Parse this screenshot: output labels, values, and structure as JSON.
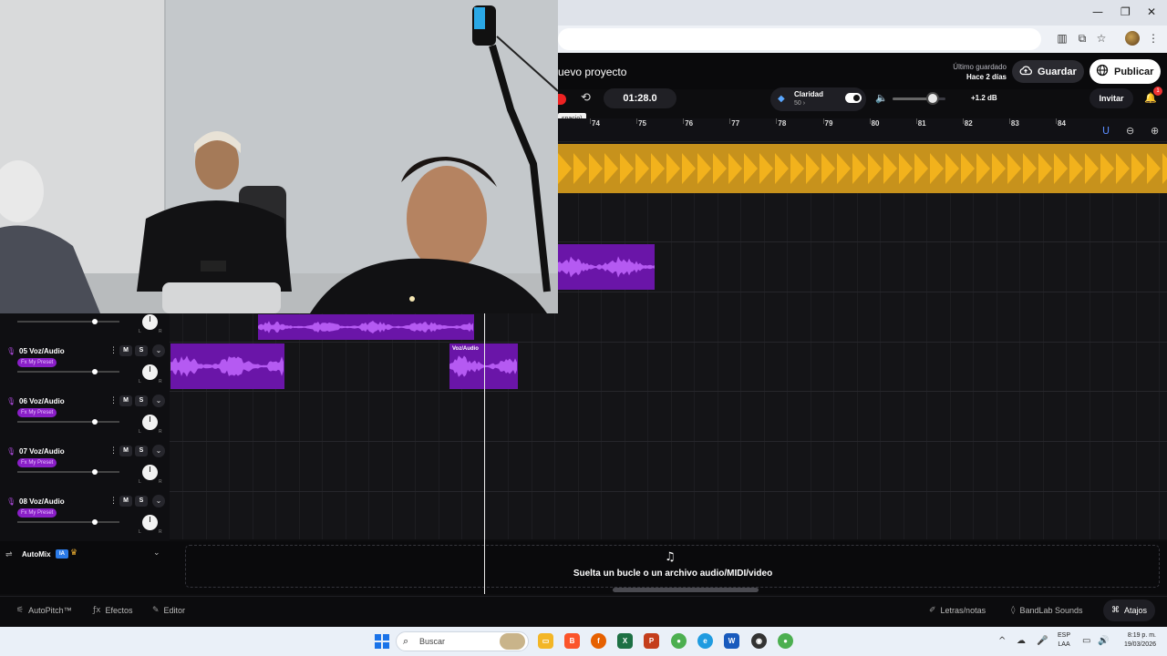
{
  "app": {
    "project_title": "uevo proyecto",
    "last_saved_label": "Último guardado",
    "last_saved_time": "Hace 2 días",
    "save_label": "Guardar",
    "publish_label": "Publicar",
    "invite_label": "Invitar",
    "notification_count": "1"
  },
  "transport": {
    "timecode": "01:28.0",
    "tooltip": "spacio)",
    "clarity_label": "Claridad",
    "clarity_value": "50 ›",
    "clarity_enabled": true,
    "master_volume_db": "+1.2 dB",
    "master_volume_level": 0.75
  },
  "ruler": {
    "bars": [
      "74",
      "75",
      "76",
      "77",
      "78",
      "79",
      "80",
      "81",
      "82",
      "83",
      "84"
    ]
  },
  "tracks": [
    {
      "number_name": "05 Voz/Audio",
      "fx": "Fx My Preset",
      "volume": 0.76,
      "mute": "M",
      "solo": "S",
      "clips": [
        {
          "label": ""
        },
        {
          "label": "Voz/Audio"
        }
      ]
    },
    {
      "number_name": "06 Voz/Audio",
      "fx": "Fx My Preset",
      "volume": 0.76,
      "mute": "M",
      "solo": "S"
    },
    {
      "number_name": "07 Voz/Audio",
      "fx": "Fx My Preset",
      "volume": 0.76,
      "mute": "M",
      "solo": "S"
    },
    {
      "number_name": "08 Voz/Audio",
      "fx": "Fx My Preset",
      "volume": 0.76,
      "mute": "M",
      "solo": "S"
    }
  ],
  "partial_track": {
    "volume": 0.76
  },
  "automix": {
    "label": "AutoMix",
    "badge": "IA"
  },
  "drop_zone": {
    "text": "Suelta un bucle o un archivo audio/MIDI/video"
  },
  "bottom_toolbar": {
    "autopitch": "AutoPitch™",
    "effects": "Efectos",
    "editor": "Editor",
    "lyrics": "Letras/notas",
    "sounds": "BandLab Sounds",
    "shortcuts": "Atajos"
  },
  "taskbar": {
    "search_placeholder": "Buscar",
    "lang_line1": "ESP",
    "lang_line2": "LAA",
    "time": "8:19 p. m.",
    "date": "19/03/2026"
  },
  "colors": {
    "beat_clip": "#c7921c",
    "vocal_clip": "#6a15a8",
    "fx_badge": "#8a1fc8",
    "record": "#ee2222",
    "accent_blue": "#2b7be9"
  }
}
